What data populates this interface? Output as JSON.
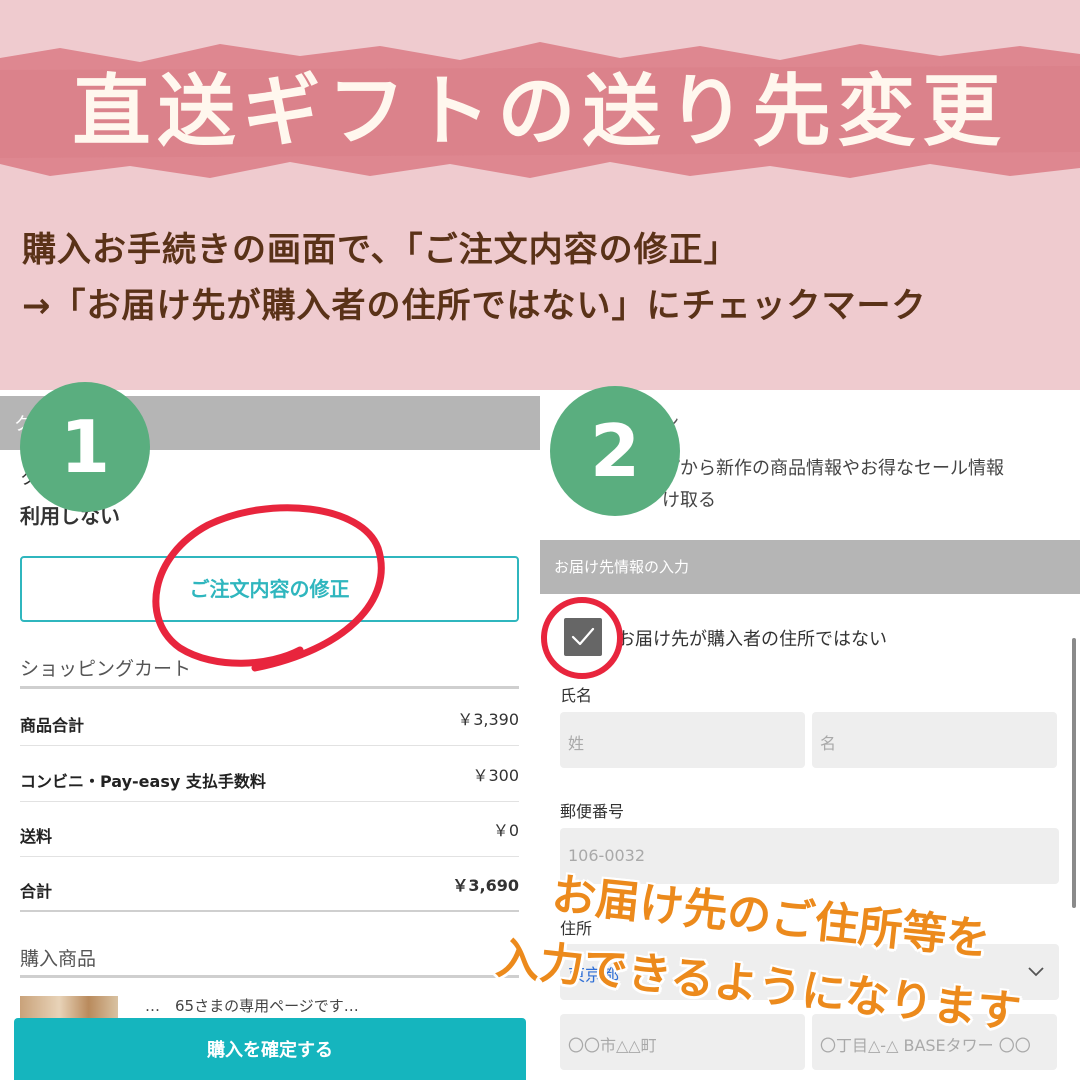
{
  "header": {
    "title": "直送ギフトの送り先変更",
    "instruction_line1": "購入お手続きの画面で、「ご注文内容の修正」",
    "instruction_line2": "→「お届け先が購入者の住所ではない」にチェックマーク"
  },
  "badges": {
    "step1": "1",
    "step2": "2"
  },
  "panel1": {
    "top_bar_partial": "ク",
    "coupon_partial": "ク",
    "coupon_value": "利用しない",
    "edit_order_label": "ご注文内容の修正",
    "cart_heading": "ショッピングカート",
    "summary": [
      {
        "label": "商品合計",
        "value": "￥3,390"
      },
      {
        "label": "コンビニ・Pay-easy 支払手数料",
        "value": "￥300"
      },
      {
        "label": "送料",
        "value": "￥0"
      },
      {
        "label": "合計",
        "value": "￥3,690"
      }
    ],
    "products_heading": "購入商品",
    "product_name_partial": "…　65さまの専用ページです…",
    "confirm_label": "購入を確定する"
  },
  "panel2": {
    "news_partial": "ン",
    "news_line1": "プから新作の商品情報やお得なセール情報",
    "news_line2": "け取る",
    "section_title": "お届け先情報の入力",
    "checkbox_label": "お届け先が購入者の住所ではない",
    "checkbox_checked": true,
    "name_label": "氏名",
    "last_name_placeholder": "姓",
    "first_name_placeholder": "名",
    "zip_label": "郵便番号",
    "zip_placeholder": "106-0032",
    "address_label": "住所",
    "prefecture_value": "東京都",
    "city_placeholder": "〇〇市△△町",
    "street_placeholder": "〇丁目△-△ BASEタワー 〇〇"
  },
  "callout": {
    "line1": "お届け先のご住所等を",
    "line2": "入力できるようになります"
  },
  "colors": {
    "header_bg": "#efcbcf",
    "banner": "#de8790",
    "instruction_text": "#5a3218",
    "badge": "#5aae7f",
    "ring": "#e8253d",
    "accent_teal": "#15b5be",
    "callout_orange": "#ec8a1c"
  }
}
